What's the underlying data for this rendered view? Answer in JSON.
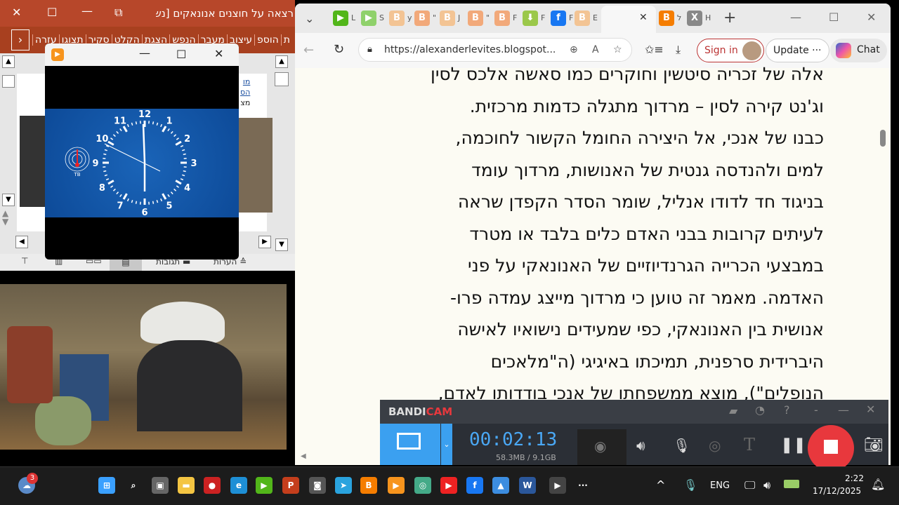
{
  "powerpoint": {
    "title": "רצאה על חוצנים אנונאקים [נש...",
    "ribbon_tabs": [
      "ת",
      "הוספ",
      "עיצוב",
      "מעבר",
      "הנפש",
      "הצגת",
      "הקלט",
      "סקיר",
      "תצוגו",
      "עזרה"
    ],
    "slide_links": [
      "מו",
      "הס",
      "מצ"
    ],
    "status": {
      "notes": "הערות",
      "comments": "תגובות"
    }
  },
  "video_player": {
    "clock_numbers": [
      "12",
      "1",
      "2",
      "3",
      "4",
      "5",
      "6",
      "7",
      "8",
      "9",
      "10",
      "11"
    ],
    "logo_text": "TB"
  },
  "browser": {
    "tabs": [
      {
        "icon": "rumble-icon",
        "label": "L",
        "color": "#52b61a"
      },
      {
        "icon": "rumble-icon",
        "label": "S",
        "color": "#8fd16b"
      },
      {
        "icon": "blogger-icon",
        "label": "y",
        "color": "#f3c494"
      },
      {
        "icon": "blogger-icon",
        "label": "\"",
        "color": "#f2a97a"
      },
      {
        "icon": "blogger-icon",
        "label": "J",
        "color": "#f3c494"
      },
      {
        "icon": "blogger-icon",
        "label": "\"",
        "color": "#f2a97a"
      },
      {
        "icon": "blogger-icon",
        "label": "F",
        "color": "#f2a97a"
      },
      {
        "icon": "download-icon",
        "label": "F",
        "color": "#9bc84a"
      },
      {
        "icon": "facebook-icon",
        "label": "F",
        "color": "#1877f2"
      },
      {
        "icon": "blogger-icon",
        "label": "E",
        "color": "#f3c494",
        "active": true
      },
      {
        "icon": "blogger-icon",
        "label": "ל",
        "color": "#f57d00"
      },
      {
        "icon": "x-icon",
        "label": "H",
        "color": "#888888"
      }
    ],
    "url": "https://alexanderlevites.blogspot...",
    "sign_in": "Sign in",
    "update": "Update",
    "chat": "Chat",
    "article_lines": [
      "אלה של זכריה סיטשין וחוקרים כמו סאשה אלכס לסין",
      "וג'נט קירה לסין – מרדוך מתגלה כדמות מרכזית.",
      " כבנו של אנכי, אל היצירה החומל הקשור לחוכמה,",
      "למים ולהנדסה גנטית של האנושות, מרדוך עומד",
      "בניגוד חד לדודו אנליל, שומר הסדר הקפדן שראה",
      "לעיתים קרובות בבני האדם כלים בלבד או מטרד",
      "במבצעי הכרייה הגרנדיוזיים של האנונאקי על פני",
      "האדמה. מאמר זה טוען כי מרדוך מייצג עמדה פרו-",
      "אנושית בין האנונאקי, כפי שמעידים נישואיו לאישה",
      "היברידית סרפנית, תמיכתו באיגיגי (ה\"מלאכים",
      "הנופלים\"), מוצא ממשפחתו של אנכי בודדותו לאדם,"
    ]
  },
  "bandicam": {
    "logo_a": "BANDI",
    "logo_b": "CAM",
    "timer": "00:02:13",
    "size": "58.3MB / 9.1GB",
    "accent": "#3ba0f0",
    "stop_color": "#e8383d"
  },
  "taskbar": {
    "weather_badge": "3",
    "lang": "ENG",
    "time": "2:22",
    "date": "17/12/2025"
  }
}
